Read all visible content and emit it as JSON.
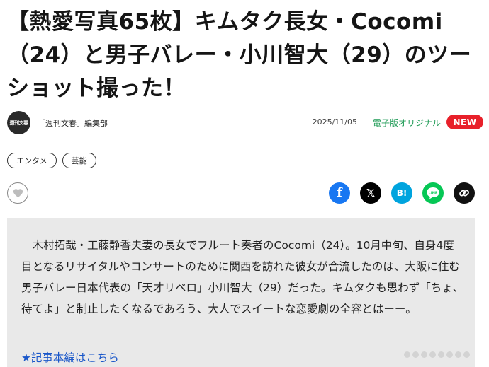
{
  "article": {
    "headline": "【熱愛写真65枚】キムタク長女・Cocomi（24）と男子バレー・小川智大（29）のツーショット撮った！",
    "publisher": {
      "logo_text": "週刊文春",
      "name": "「週刊文春」編集部"
    },
    "date": "2025/11/05",
    "source_tag": "電子版オリジナル",
    "badge": "NEW",
    "tags": [
      "エンタメ",
      "芸能"
    ],
    "summary": "木村拓哉・工藤静香夫妻の長女でフルート奏者のCocomi（24）。10月中旬、自身4度目となるリサイタルやコンサートのために関西を訪れた彼女が合流したのは、大阪に住む男子バレー日本代表の「天才リベロ」小川智大（29）だった。キムタクも思わず「ちょ、待てよ」と制止したくなるであろう、大人でスイートな恋愛劇の全容とはーー。",
    "more_link": "★記事本編はこちら"
  },
  "share": {
    "facebook": "f",
    "x": "𝕏",
    "hatena": "B!",
    "line": "LINE"
  },
  "icons": {
    "like": "heart-icon",
    "link": "link-icon"
  },
  "colors": {
    "badge_red": "#e8202a",
    "source_green": "#1f9b56",
    "link_blue": "#1a57c9",
    "summary_bg": "#e9e9e9"
  }
}
